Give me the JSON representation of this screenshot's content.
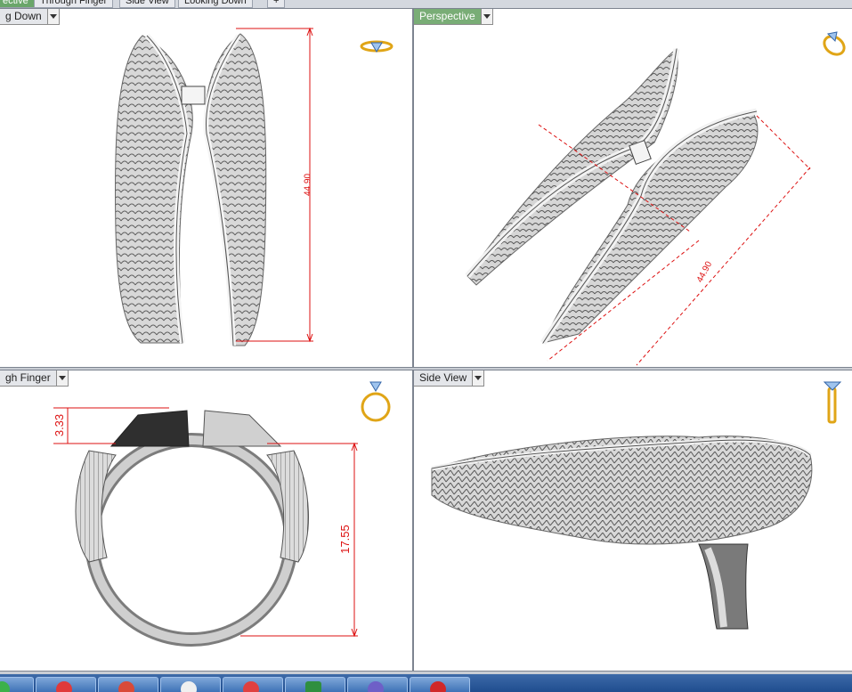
{
  "top_tabs": [
    "ective",
    "Through Finger",
    "Side View",
    "Looking Down",
    "+"
  ],
  "viewports": {
    "top_left": {
      "title": "g Down",
      "dimension": "44.90"
    },
    "top_right": {
      "title": "Perspective",
      "dimension": "44.90"
    },
    "bottom_left": {
      "title": "gh Finger",
      "dimension_height": "17.55",
      "dimension_top": "3.33"
    },
    "bottom_right": {
      "title": "Side View"
    }
  },
  "colors": {
    "active_tab": "#79ad76",
    "dimension_line": "#dd1111",
    "taskbar": "#2b5a9a"
  },
  "icons": [
    "ring-top-icon",
    "ring-perspective-icon",
    "ring-front-icon",
    "ring-side-icon"
  ],
  "taskbar_items": [
    "start-icon",
    "app-red-icon",
    "chrome-icon",
    "app-x-icon",
    "app-x2-icon",
    "excel-icon",
    "app-purple-icon",
    "app-red2-icon"
  ]
}
